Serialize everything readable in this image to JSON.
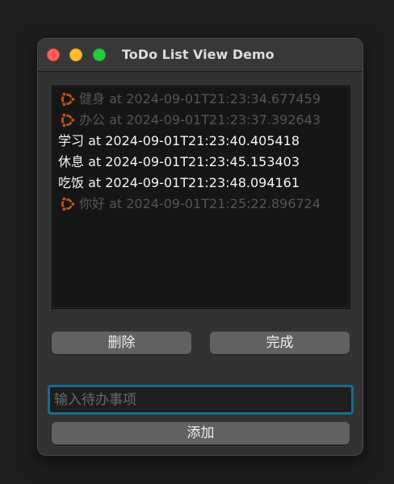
{
  "window": {
    "title": "ToDo List View Demo"
  },
  "todos": [
    {
      "text": "健身 at 2024-09-01T21:23:34.677459",
      "done": true
    },
    {
      "text": "办公 at 2024-09-01T21:23:37.392643",
      "done": true
    },
    {
      "text": "学习 at 2024-09-01T21:23:40.405418",
      "done": false
    },
    {
      "text": "休息 at 2024-09-01T21:23:45.153403",
      "done": false
    },
    {
      "text": "吃饭 at 2024-09-01T21:23:48.094161",
      "done": false
    },
    {
      "text": "你好 at 2024-09-01T21:25:22.896724",
      "done": true
    }
  ],
  "done_icon": "ubuntu-logo-icon",
  "buttons": {
    "delete": "删除",
    "complete": "完成",
    "add": "添加"
  },
  "input": {
    "value": "",
    "placeholder": "输入待办事项"
  },
  "colors": {
    "done_icon": "#c2541d",
    "focus_ring": "#1b6a91",
    "close": "#ff5f57",
    "minimize": "#febc2e",
    "zoom": "#28c840"
  }
}
